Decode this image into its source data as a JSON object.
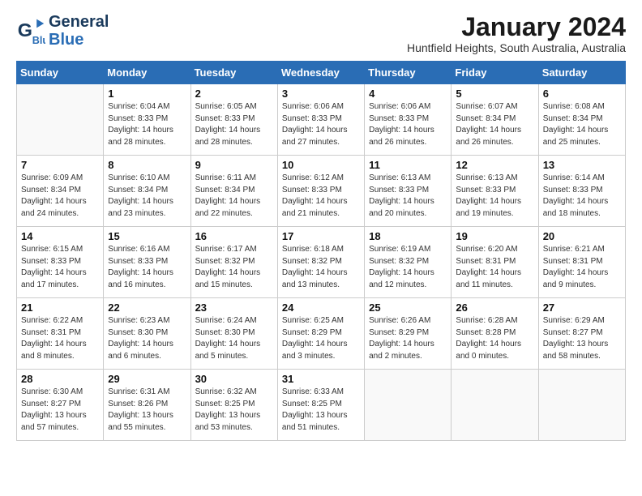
{
  "header": {
    "logo_line1": "General",
    "logo_line2": "Blue",
    "month": "January 2024",
    "location": "Huntfield Heights, South Australia, Australia"
  },
  "weekdays": [
    "Sunday",
    "Monday",
    "Tuesday",
    "Wednesday",
    "Thursday",
    "Friday",
    "Saturday"
  ],
  "weeks": [
    [
      {
        "day": "",
        "sunrise": "",
        "sunset": "",
        "daylight": ""
      },
      {
        "day": "1",
        "sunrise": "Sunrise: 6:04 AM",
        "sunset": "Sunset: 8:33 PM",
        "daylight": "Daylight: 14 hours and 28 minutes."
      },
      {
        "day": "2",
        "sunrise": "Sunrise: 6:05 AM",
        "sunset": "Sunset: 8:33 PM",
        "daylight": "Daylight: 14 hours and 28 minutes."
      },
      {
        "day": "3",
        "sunrise": "Sunrise: 6:06 AM",
        "sunset": "Sunset: 8:33 PM",
        "daylight": "Daylight: 14 hours and 27 minutes."
      },
      {
        "day": "4",
        "sunrise": "Sunrise: 6:06 AM",
        "sunset": "Sunset: 8:33 PM",
        "daylight": "Daylight: 14 hours and 26 minutes."
      },
      {
        "day": "5",
        "sunrise": "Sunrise: 6:07 AM",
        "sunset": "Sunset: 8:34 PM",
        "daylight": "Daylight: 14 hours and 26 minutes."
      },
      {
        "day": "6",
        "sunrise": "Sunrise: 6:08 AM",
        "sunset": "Sunset: 8:34 PM",
        "daylight": "Daylight: 14 hours and 25 minutes."
      }
    ],
    [
      {
        "day": "7",
        "sunrise": "Sunrise: 6:09 AM",
        "sunset": "Sunset: 8:34 PM",
        "daylight": "Daylight: 14 hours and 24 minutes."
      },
      {
        "day": "8",
        "sunrise": "Sunrise: 6:10 AM",
        "sunset": "Sunset: 8:34 PM",
        "daylight": "Daylight: 14 hours and 23 minutes."
      },
      {
        "day": "9",
        "sunrise": "Sunrise: 6:11 AM",
        "sunset": "Sunset: 8:34 PM",
        "daylight": "Daylight: 14 hours and 22 minutes."
      },
      {
        "day": "10",
        "sunrise": "Sunrise: 6:12 AM",
        "sunset": "Sunset: 8:33 PM",
        "daylight": "Daylight: 14 hours and 21 minutes."
      },
      {
        "day": "11",
        "sunrise": "Sunrise: 6:13 AM",
        "sunset": "Sunset: 8:33 PM",
        "daylight": "Daylight: 14 hours and 20 minutes."
      },
      {
        "day": "12",
        "sunrise": "Sunrise: 6:13 AM",
        "sunset": "Sunset: 8:33 PM",
        "daylight": "Daylight: 14 hours and 19 minutes."
      },
      {
        "day": "13",
        "sunrise": "Sunrise: 6:14 AM",
        "sunset": "Sunset: 8:33 PM",
        "daylight": "Daylight: 14 hours and 18 minutes."
      }
    ],
    [
      {
        "day": "14",
        "sunrise": "Sunrise: 6:15 AM",
        "sunset": "Sunset: 8:33 PM",
        "daylight": "Daylight: 14 hours and 17 minutes."
      },
      {
        "day": "15",
        "sunrise": "Sunrise: 6:16 AM",
        "sunset": "Sunset: 8:33 PM",
        "daylight": "Daylight: 14 hours and 16 minutes."
      },
      {
        "day": "16",
        "sunrise": "Sunrise: 6:17 AM",
        "sunset": "Sunset: 8:32 PM",
        "daylight": "Daylight: 14 hours and 15 minutes."
      },
      {
        "day": "17",
        "sunrise": "Sunrise: 6:18 AM",
        "sunset": "Sunset: 8:32 PM",
        "daylight": "Daylight: 14 hours and 13 minutes."
      },
      {
        "day": "18",
        "sunrise": "Sunrise: 6:19 AM",
        "sunset": "Sunset: 8:32 PM",
        "daylight": "Daylight: 14 hours and 12 minutes."
      },
      {
        "day": "19",
        "sunrise": "Sunrise: 6:20 AM",
        "sunset": "Sunset: 8:31 PM",
        "daylight": "Daylight: 14 hours and 11 minutes."
      },
      {
        "day": "20",
        "sunrise": "Sunrise: 6:21 AM",
        "sunset": "Sunset: 8:31 PM",
        "daylight": "Daylight: 14 hours and 9 minutes."
      }
    ],
    [
      {
        "day": "21",
        "sunrise": "Sunrise: 6:22 AM",
        "sunset": "Sunset: 8:31 PM",
        "daylight": "Daylight: 14 hours and 8 minutes."
      },
      {
        "day": "22",
        "sunrise": "Sunrise: 6:23 AM",
        "sunset": "Sunset: 8:30 PM",
        "daylight": "Daylight: 14 hours and 6 minutes."
      },
      {
        "day": "23",
        "sunrise": "Sunrise: 6:24 AM",
        "sunset": "Sunset: 8:30 PM",
        "daylight": "Daylight: 14 hours and 5 minutes."
      },
      {
        "day": "24",
        "sunrise": "Sunrise: 6:25 AM",
        "sunset": "Sunset: 8:29 PM",
        "daylight": "Daylight: 14 hours and 3 minutes."
      },
      {
        "day": "25",
        "sunrise": "Sunrise: 6:26 AM",
        "sunset": "Sunset: 8:29 PM",
        "daylight": "Daylight: 14 hours and 2 minutes."
      },
      {
        "day": "26",
        "sunrise": "Sunrise: 6:28 AM",
        "sunset": "Sunset: 8:28 PM",
        "daylight": "Daylight: 14 hours and 0 minutes."
      },
      {
        "day": "27",
        "sunrise": "Sunrise: 6:29 AM",
        "sunset": "Sunset: 8:27 PM",
        "daylight": "Daylight: 13 hours and 58 minutes."
      }
    ],
    [
      {
        "day": "28",
        "sunrise": "Sunrise: 6:30 AM",
        "sunset": "Sunset: 8:27 PM",
        "daylight": "Daylight: 13 hours and 57 minutes."
      },
      {
        "day": "29",
        "sunrise": "Sunrise: 6:31 AM",
        "sunset": "Sunset: 8:26 PM",
        "daylight": "Daylight: 13 hours and 55 minutes."
      },
      {
        "day": "30",
        "sunrise": "Sunrise: 6:32 AM",
        "sunset": "Sunset: 8:25 PM",
        "daylight": "Daylight: 13 hours and 53 minutes."
      },
      {
        "day": "31",
        "sunrise": "Sunrise: 6:33 AM",
        "sunset": "Sunset: 8:25 PM",
        "daylight": "Daylight: 13 hours and 51 minutes."
      },
      {
        "day": "",
        "sunrise": "",
        "sunset": "",
        "daylight": ""
      },
      {
        "day": "",
        "sunrise": "",
        "sunset": "",
        "daylight": ""
      },
      {
        "day": "",
        "sunrise": "",
        "sunset": "",
        "daylight": ""
      }
    ]
  ]
}
